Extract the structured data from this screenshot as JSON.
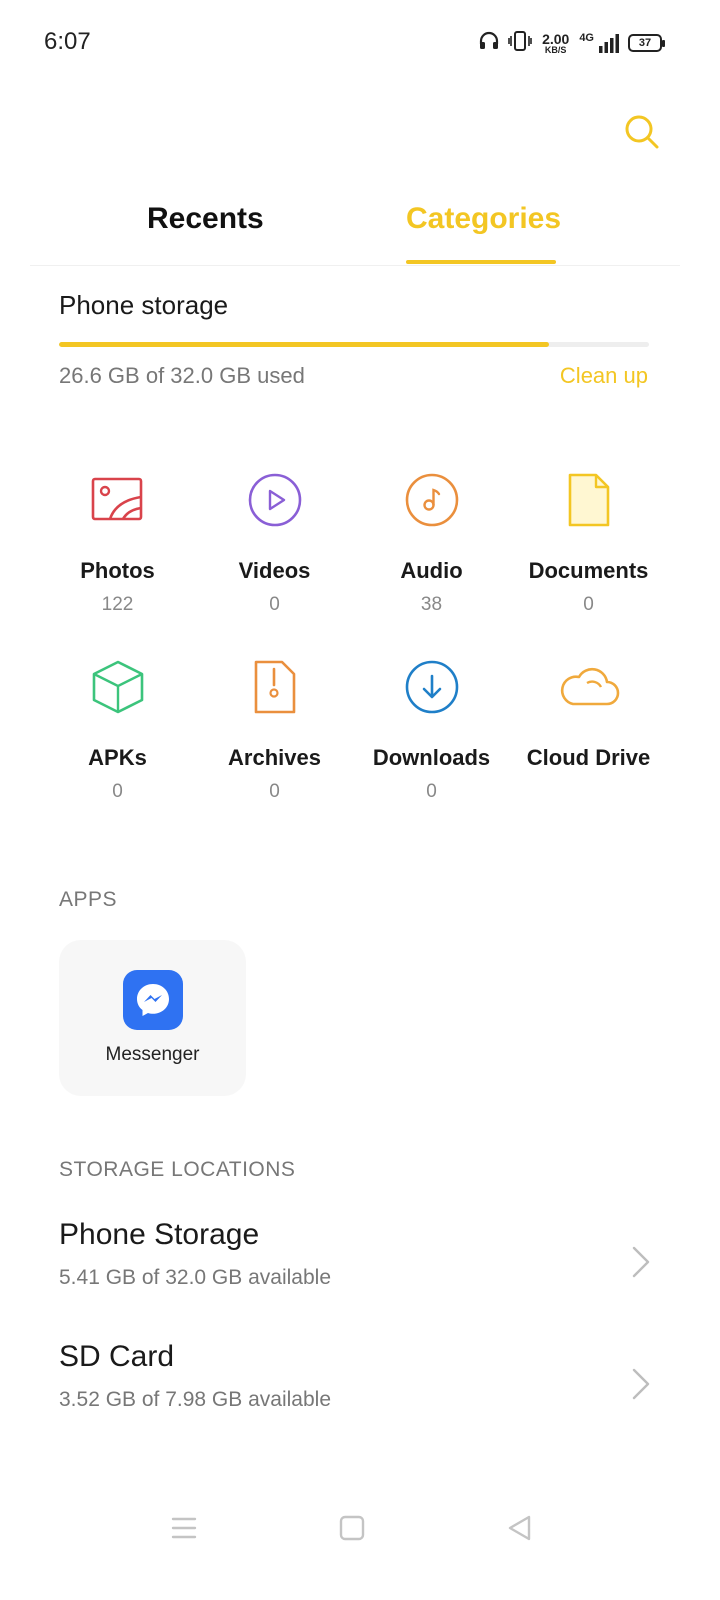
{
  "status_bar": {
    "time": "6:07",
    "net_speed_value": "2.00",
    "net_speed_unit": "KB/S",
    "network_type": "4G",
    "battery": "37"
  },
  "search": {
    "icon": "search-icon"
  },
  "tabs": [
    {
      "label": "Recents",
      "active": false
    },
    {
      "label": "Categories",
      "active": true
    }
  ],
  "accent_color": "#f3c623",
  "storage": {
    "title": "Phone storage",
    "usage": "26.6 GB of 32.0 GB used",
    "used_fraction": 0.83,
    "cleanup_label": "Clean up"
  },
  "categories": [
    {
      "label": "Photos",
      "count": "122",
      "icon": "photo-icon",
      "color": "#d9434b"
    },
    {
      "label": "Videos",
      "count": "0",
      "icon": "play-icon",
      "color": "#8a5fd6"
    },
    {
      "label": "Audio",
      "count": "38",
      "icon": "music-note-icon",
      "color": "#ea8f3d"
    },
    {
      "label": "Documents",
      "count": "0",
      "icon": "document-icon",
      "color": "#f3c623"
    },
    {
      "label": "APKs",
      "count": "0",
      "icon": "cube-icon",
      "color": "#3cc47c"
    },
    {
      "label": "Archives",
      "count": "0",
      "icon": "archive-icon",
      "color": "#ea8f3d"
    },
    {
      "label": "Downloads",
      "count": "0",
      "icon": "download-icon",
      "color": "#1f7fc8"
    },
    {
      "label": "Cloud Drive",
      "count": "",
      "icon": "cloud-icon",
      "color": "#f0a93c"
    }
  ],
  "apps": {
    "heading": "APPS",
    "items": [
      {
        "name": "Messenger",
        "icon": "messenger-icon",
        "color": "#2f72f2"
      }
    ]
  },
  "storage_locations": {
    "heading": "STORAGE LOCATIONS",
    "items": [
      {
        "name": "Phone Storage",
        "detail": "5.41 GB of 32.0 GB available"
      },
      {
        "name": "SD Card",
        "detail": "3.52 GB of 7.98 GB available"
      }
    ]
  },
  "nav_bar": {
    "menu_icon": "menu-icon",
    "home_icon": "home-icon",
    "back_icon": "back-icon"
  }
}
